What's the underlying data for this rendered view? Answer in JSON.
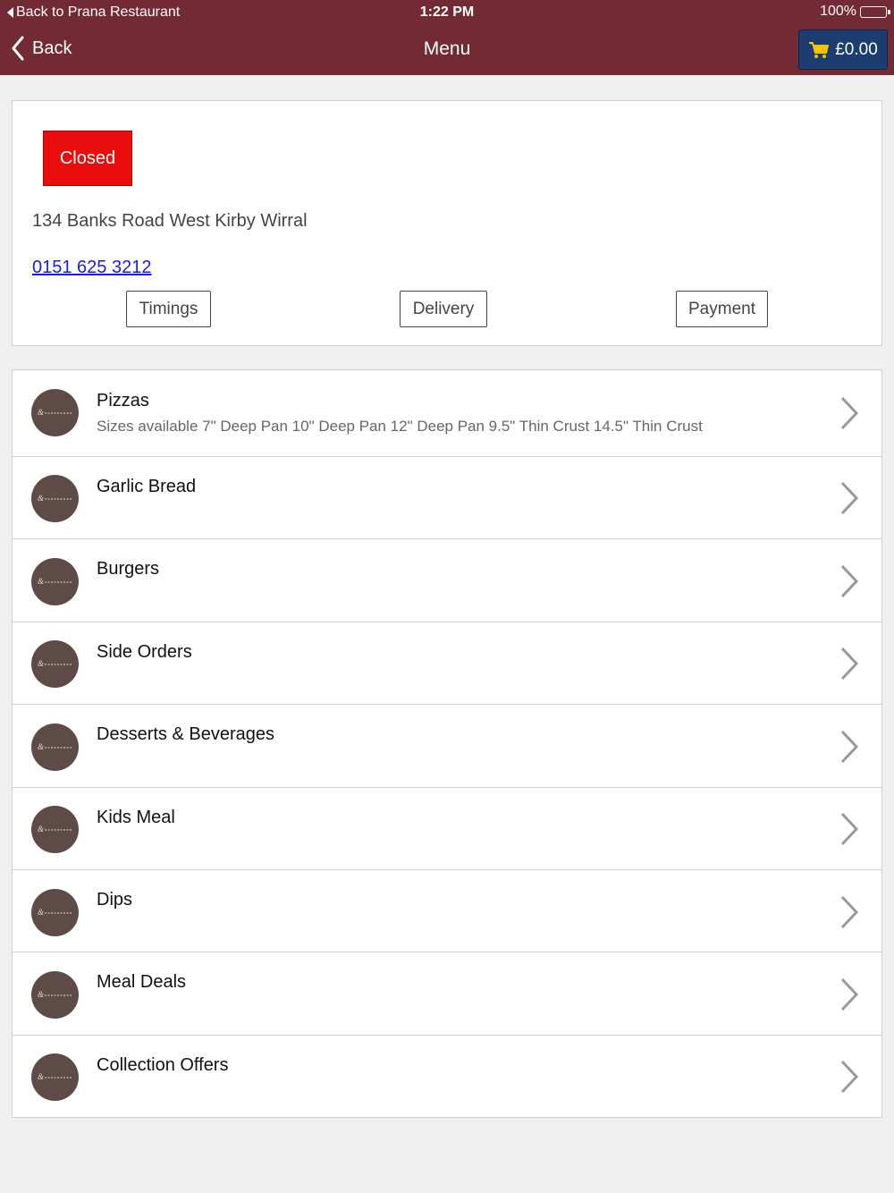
{
  "status_bar": {
    "back_app": "Back to Prana Restaurant",
    "time": "1:22 PM",
    "battery": "100%"
  },
  "nav": {
    "back_label": "Back",
    "title": "Menu",
    "cart_total": "£0.00"
  },
  "restaurant": {
    "status": "Closed",
    "address": "134 Banks Road West Kirby Wirral",
    "phone": "0151 625 3212",
    "tabs": [
      "Timings",
      "Delivery",
      "Payment"
    ]
  },
  "categories": [
    {
      "title": "Pizzas",
      "subtitle": "Sizes available 7\" Deep Pan 10\" Deep Pan 12\" Deep Pan 9.5\" Thin Crust 14.5\" Thin Crust"
    },
    {
      "title": "Garlic Bread"
    },
    {
      "title": "Burgers"
    },
    {
      "title": "Side Orders"
    },
    {
      "title": "Desserts & Beverages"
    },
    {
      "title": "Kids Meal"
    },
    {
      "title": "Dips"
    },
    {
      "title": "Meal Deals"
    },
    {
      "title": "Collection Offers"
    }
  ]
}
